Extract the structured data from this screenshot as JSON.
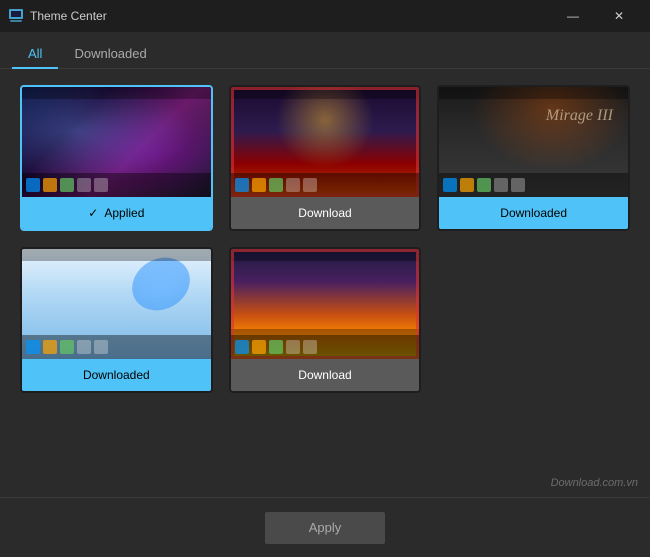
{
  "titleBar": {
    "title": "Theme Center",
    "minimizeLabel": "—",
    "closeLabel": "✕"
  },
  "tabs": [
    {
      "id": "all",
      "label": "All",
      "active": true
    },
    {
      "id": "downloaded",
      "label": "Downloaded",
      "active": false
    }
  ],
  "themes": [
    {
      "id": 1,
      "previewClass": "theme-preview-1",
      "labelText": "Applied",
      "labelClass": "applied",
      "hasCheck": true,
      "hasRedBorder": false,
      "isActive": true
    },
    {
      "id": 2,
      "previewClass": "theme-preview-2",
      "labelText": "Download",
      "labelClass": "download",
      "hasCheck": false,
      "hasRedBorder": true,
      "isActive": false
    },
    {
      "id": 3,
      "previewClass": "theme-preview-3",
      "labelText": "Downloaded",
      "labelClass": "downloaded",
      "hasCheck": false,
      "hasRedBorder": false,
      "isActive": false,
      "hasMirageText": true
    },
    {
      "id": 4,
      "previewClass": "theme-preview-4",
      "labelText": "Downloaded",
      "labelClass": "downloaded",
      "hasCheck": false,
      "hasRedBorder": false,
      "isActive": false
    },
    {
      "id": 5,
      "previewClass": "theme-preview-5",
      "labelText": "Download",
      "labelClass": "download",
      "hasCheck": false,
      "hasRedBorder": true,
      "isActive": false
    }
  ],
  "applyButton": {
    "label": "Apply"
  },
  "watermark": "Download.com.vn"
}
